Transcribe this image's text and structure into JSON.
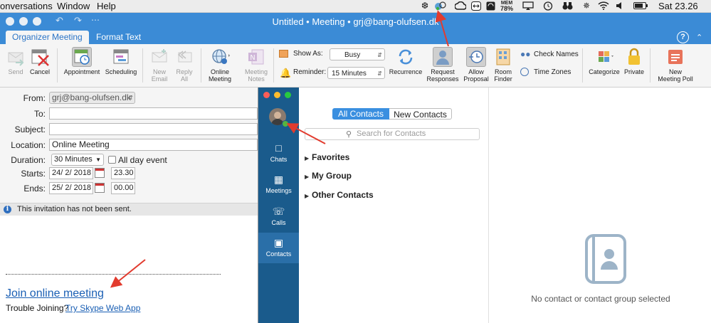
{
  "menubar": {
    "items": [
      "onversations",
      "Window",
      "Help"
    ],
    "mem_label": "MEM",
    "mem_value": "78%",
    "clock": "Sat 23.26"
  },
  "window": {
    "title": "Untitled • Meeting • grj@bang-olufsen.dk"
  },
  "ribbon_tabs": [
    "Organizer Meeting",
    "Format Text"
  ],
  "ribbon": {
    "send": "Send",
    "cancel": "Cancel",
    "appointment": "Appointment",
    "scheduling": "Scheduling",
    "new_email_1": "New",
    "new_email_2": "Email",
    "reply_all_1": "Reply",
    "reply_all_2": "All",
    "online_meeting_1": "Online",
    "online_meeting_2": "Meeting",
    "meeting_notes_1": "Meeting",
    "meeting_notes_2": "Notes",
    "show_as_label": "Show As:",
    "show_as_value": "Busy",
    "reminder_label": "Reminder:",
    "reminder_value": "15 Minutes",
    "recurrence": "Recurrence",
    "request_responses_1": "Request",
    "request_responses_2": "Responses",
    "allow_proposal_1": "Allow",
    "allow_proposal_2": "Proposal",
    "room_finder_1": "Room",
    "room_finder_2": "Finder",
    "check_names": "Check Names",
    "time_zones": "Time Zones",
    "categorize": "Categorize",
    "private": "Private",
    "new_poll_1": "New",
    "new_poll_2": "Meeting Poll"
  },
  "form": {
    "from_label": "From:",
    "from_value": "grj@bang-olufsen.dk",
    "to_label": "To:",
    "to_value": "",
    "subject_label": "Subject:",
    "subject_value": "",
    "location_label": "Location:",
    "location_value": "Online Meeting",
    "duration_label": "Duration:",
    "duration_value": "30 Minutes",
    "all_day_label": "All day event",
    "starts_label": "Starts:",
    "starts_date": "24/  2/ 2018",
    "starts_time": "23.30",
    "ends_label": "Ends:",
    "ends_date": "25/  2/ 2018",
    "ends_time": "00.00"
  },
  "info_message": "This invitation has not been sent.",
  "body": {
    "join_link": "Join online meeting",
    "trouble_text": "Trouble Joining?",
    "web_app_link": "Try Skype Web App"
  },
  "skype": {
    "nav": [
      "Chats",
      "Meetings",
      "Calls",
      "Contacts"
    ],
    "segment_all": "All Contacts",
    "segment_new": "New Contacts",
    "search_placeholder": "Search for Contacts",
    "groups": [
      "Favorites",
      "My Group",
      "Other Contacts"
    ],
    "empty_state": "No contact or contact group selected"
  },
  "colors": {
    "outlook_blue": "#3b8bd6",
    "skype_sidebar": "#1a5b8c",
    "annotation_red": "#e23b2e",
    "link_blue": "#1a5fb4",
    "segment_selected": "#3a8fe0"
  }
}
